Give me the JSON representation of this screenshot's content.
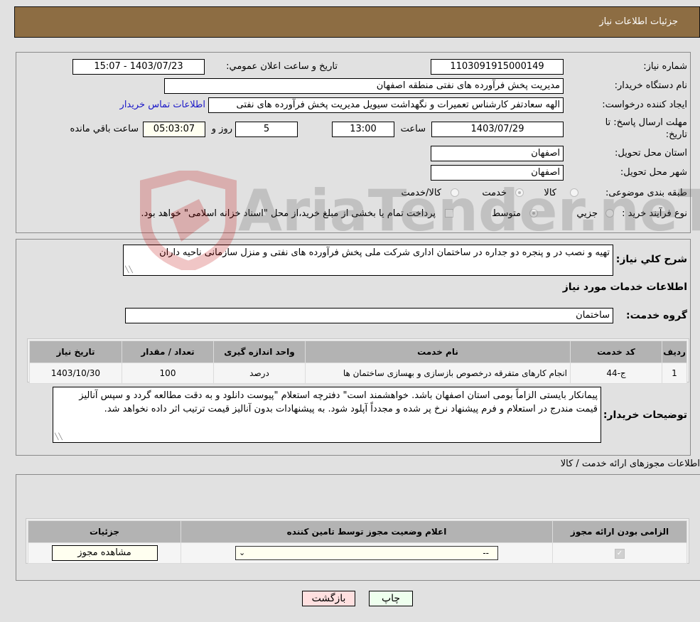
{
  "header": {
    "title": "جزئیات اطلاعات نیاز"
  },
  "need_info": {
    "need_number_label": "شماره نیاز:",
    "need_number": "1103091915000149",
    "announce_label": "تاریخ و ساعت اعلان عمومي:",
    "announce_value": "1403/07/23 - 15:07",
    "buyer_org_label": "نام دستگاه خریدار:",
    "buyer_org": "مدیریت پخش فرآورده های نفتی منطقه اصفهان",
    "creator_label": "ایجاد کننده درخواست:",
    "creator": "الهه سعادتفر کارشناس تعمیرات و نگهداشت سیویل مدیریت پخش فرآورده های نفتی",
    "contact_link": "اطلاعات تماس خریدار",
    "deadline_label_line1": "مهلت ارسال پاسخ: تا",
    "deadline_label_line2": "تاریخ:",
    "deadline_date": "1403/07/29",
    "time_label": "ساعت",
    "deadline_time": "13:00",
    "days_value": "5",
    "days_label": "روز و",
    "remaining_value": "05:03:07",
    "remaining_label": "ساعت باقي مانده",
    "province_label": "استان محل تحویل:",
    "province": "اصفهان",
    "city_label": "شهر محل تحویل:",
    "city": "اصفهان",
    "category_label": "طبقه بندی موضوعی:",
    "category_options": [
      "کالا",
      "خدمت",
      "کالا/خدمت"
    ],
    "category_selected": "خدمت",
    "process_label": "نوع فرآیند خرید :",
    "process_options": [
      "جزيي",
      "متوسط"
    ],
    "process_selected": "متوسط",
    "treasury_note": "پرداخت تمام یا بخشی از مبلغ خرید،از محل \"اسناد خزانه اسلامی\" خواهد بود."
  },
  "description": {
    "label": "شرح کلي نیاز:",
    "text": "تهیه و نصب در و پنجره دو جداره در ساختمان اداری شرکت ملی پخش فرآورده های نفتی و منزل سازمانی ناحیه داران",
    "services_heading": "اطلاعات خدمات مورد نیاز",
    "service_group_label": "گروه خدمت:",
    "service_group": "ساختمان"
  },
  "services_table": {
    "headers": [
      "ردیف",
      "کد خدمت",
      "نام خدمت",
      "واحد اندازه گیری",
      "تعداد / مقدار",
      "تاریخ نیاز"
    ],
    "rows": [
      [
        "1",
        "ج-44",
        "انجام کارهای متفرقه درخصوص بازسازی و بهسازی ساختمان ها",
        "درصد",
        "100",
        "1403/10/30"
      ]
    ]
  },
  "buyer_notes": {
    "label": "توضیحات خریدار:",
    "text": "پیمانکار بایستی الزاماً بومی استان اصفهان باشد. خواهشمند است\" دفترچه استعلام \"پیوست دانلود و به دقت مطالعه گردد و سپس آنالیز قیمت مندرج در استعلام و فرم پیشنهاد نرخ پر شده و مجدداً آپلود شود. به پیشنهادات بدون آنالیز قیمت ترتیب اثر داده نخواهد شد."
  },
  "permits": {
    "section_title": "اطلاعات مجوزهای ارائه خدمت / کالا",
    "headers": [
      "الزامی بودن ارائه مجوز",
      "اعلام وضعیت مجوز توسط تامین کننده",
      "جزئیات"
    ],
    "rows": [
      {
        "required_checked": true,
        "status_selected": "--",
        "details_button": "مشاهده مجوز"
      }
    ]
  },
  "footer": {
    "print_button": "چاپ",
    "back_button": "بازگشت"
  },
  "watermark": {
    "text": "AriaTender.neT"
  },
  "colors": {
    "header_bg": "#8d6d43",
    "link": "#1a17c8",
    "back_button_bg": "#ffe0e0",
    "print_button_bg": "#eeffee",
    "yellow_field": "#fffff0"
  }
}
